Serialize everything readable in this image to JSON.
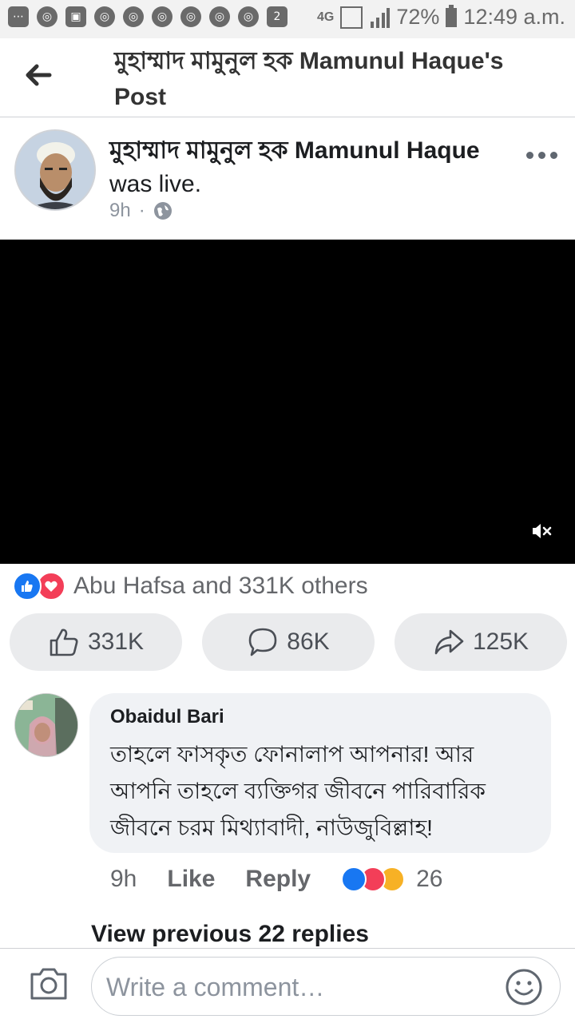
{
  "status_bar": {
    "notification_count": "2",
    "network": "4G",
    "battery": "72%",
    "time": "12:49 a.m."
  },
  "header": {
    "title": "মুহাম্মাদ মামুনুল হক Mamunul Haque's Post",
    "back_icon": "back-arrow-icon"
  },
  "post": {
    "author_bn": "মুহাম্মাদ মামুনুল হক",
    "author_en": "Mamunul Haque",
    "action": "was live.",
    "time": "9h",
    "privacy_icon": "globe-icon"
  },
  "reactions": {
    "summary": "Abu Hafsa and 331K others"
  },
  "actions": {
    "like_count": "331K",
    "comment_count": "86K",
    "share_count": "125K"
  },
  "comment": {
    "name": "Obaidul Bari",
    "text": "তাহলে ফাসকৃত ফোনালাপ আপনার! আর আপনি তাহলে ব্যক্তিগর জীবনে পারিবারিক জীবনে চরম মিথ্যাবাদী, নাউজুবিল্লাহ!",
    "time": "9h",
    "like_label": "Like",
    "reply_label": "Reply",
    "reaction_count": "26"
  },
  "view_previous": "View previous 22 replies",
  "composer": {
    "placeholder": "Write a comment…"
  },
  "colors": {
    "accent_blue": "#1877f2",
    "love_red": "#f33e58",
    "haha_yellow": "#f7b125"
  }
}
